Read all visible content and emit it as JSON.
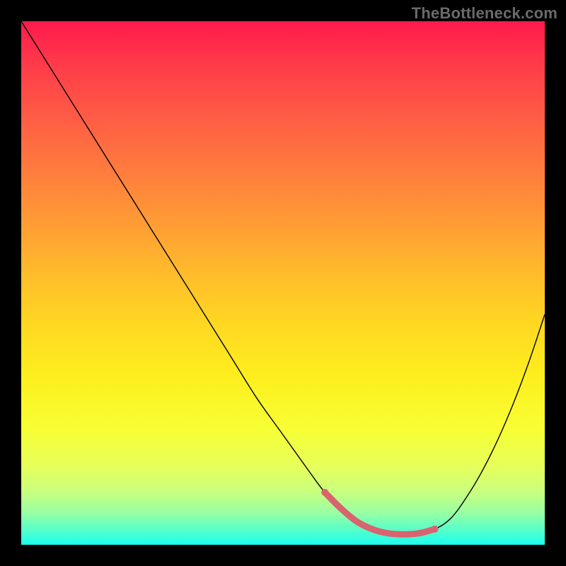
{
  "watermark": "TheBottleneck.com",
  "colors": {
    "curve": "#000000",
    "trough": "#d9636e",
    "gradient_top": "#ff1a4d",
    "gradient_bottom": "#1affef",
    "frame": "#000000"
  },
  "chart_data": {
    "type": "line",
    "title": "",
    "xlabel": "",
    "ylabel": "",
    "xlim": [
      0,
      100
    ],
    "ylim": [
      0,
      100
    ],
    "grid": false,
    "series": [
      {
        "name": "bottleneck-curve",
        "x": [
          0,
          5,
          10,
          15,
          20,
          25,
          30,
          35,
          40,
          45,
          50,
          55,
          58,
          61,
          64,
          67,
          70,
          73,
          76,
          79,
          82,
          85,
          88,
          91,
          94,
          97,
          100
        ],
        "y": [
          100,
          92,
          84,
          76,
          68,
          60,
          52,
          44,
          36,
          28,
          21,
          14,
          10,
          7,
          4.5,
          3,
          2.2,
          2,
          2.2,
          3,
          5,
          9,
          14,
          20,
          27,
          35,
          44
        ]
      }
    ],
    "trough_highlight": {
      "x": [
        58,
        61,
        64,
        67,
        70,
        73,
        76,
        79
      ],
      "y": [
        10,
        7,
        4.5,
        3,
        2.2,
        2,
        2.2,
        3
      ]
    }
  }
}
